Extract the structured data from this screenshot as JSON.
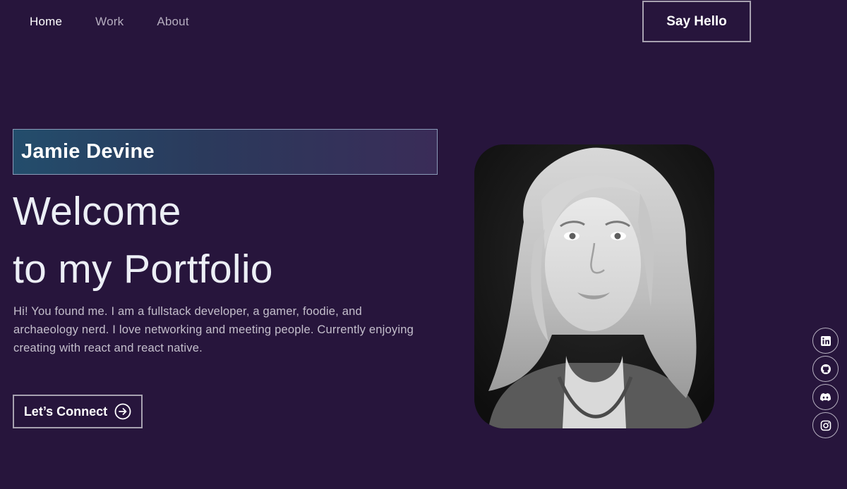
{
  "nav": {
    "links": [
      "Home",
      "Work",
      "About"
    ],
    "cta_label": "Say Hello"
  },
  "hero": {
    "name": "Jamie Devine",
    "headline_line1": "Welcome",
    "headline_line2": "to my Portfolio",
    "intro": "Hi! You found me. I am a fullstack developer, a gamer, foodie, and archaeology nerd. I love networking and meeting people. Currently enjoying creating with react and react native.",
    "connect_label": "Let’s Connect"
  },
  "social_icons": [
    "linkedin-icon",
    "github-icon",
    "discord-icon",
    "instagram-icon"
  ],
  "colors": {
    "background": "#27153c",
    "name_gradient_start": "#234d6c",
    "name_gradient_end": "#3a2c58",
    "button_border": "#a7a1b0"
  }
}
